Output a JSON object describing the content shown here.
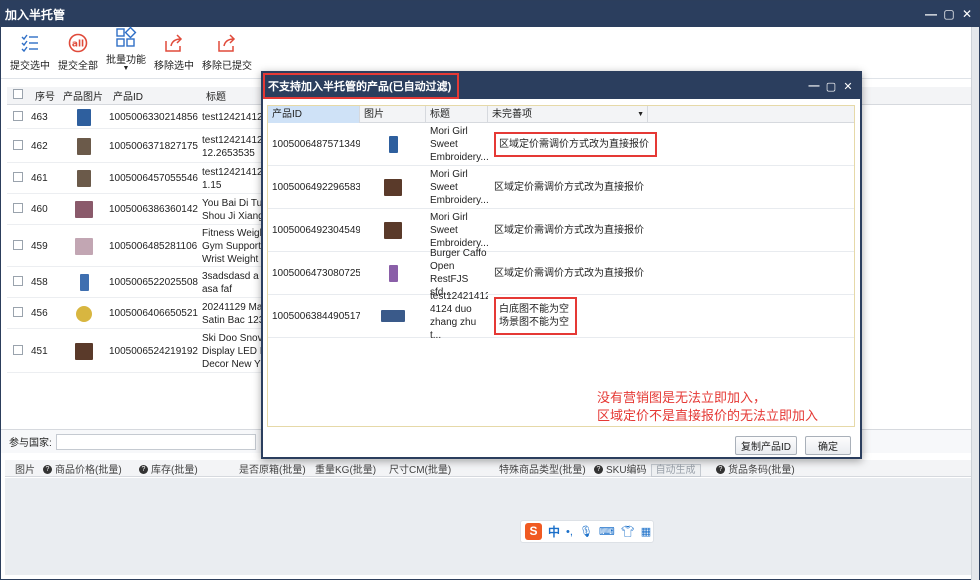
{
  "window": {
    "title": "加入半托管",
    "controls": [
      "—",
      "▢",
      "✕"
    ]
  },
  "toolbar": {
    "submit_selected": "提交选中",
    "submit_all": "提交全部",
    "batch_functions": "批量功能",
    "remove_selected": "移除选中",
    "remove_submitted": "移除已提交"
  },
  "grid": {
    "headers": {
      "no": "序号",
      "image": "产品图片",
      "pid": "产品ID",
      "title": "标题"
    },
    "rows": [
      {
        "no": "463",
        "pid": "1005006330214856",
        "title": "test12421412",
        "color": "#2e5f9e"
      },
      {
        "no": "462",
        "pid": "1005006371827175",
        "title": "test12421412\n12.2653535",
        "color": "#6b5a4a"
      },
      {
        "no": "461",
        "pid": "1005006457055546",
        "title": "test12421412\n1.15",
        "color": "#6b5a4a"
      },
      {
        "no": "460",
        "pid": "1005006386360142",
        "title": "You Bai Di Tu\nShou Ji Xiang",
        "color": "#8a5a6b"
      },
      {
        "no": "459",
        "pid": "1005006485281106",
        "title": "Fitness Weigh\nGym Support\nWrist Weight",
        "color": "#c2a6b3"
      },
      {
        "no": "458",
        "pid": "1005006522025508",
        "title": "3sadsdasd a\nasa faf",
        "color": "#3f6fb0"
      },
      {
        "no": "456",
        "pid": "1005006406650521",
        "title": "20241129 Ma\nSatin Bac 123",
        "color": "#d8b640"
      },
      {
        "no": "451",
        "pid": "1005006524219192",
        "title": "Ski Doo Snov\nDisplay LED I\nDecor New Y",
        "color": "#5a3a2a"
      }
    ]
  },
  "country": {
    "label": "参与国家:"
  },
  "sku": {
    "headers": {
      "image": "图片",
      "price": "商品价格(批量)",
      "stock": "库存(批量)",
      "original_box": "是否原箱(批量)",
      "weight": "重量KG(批量)",
      "size": "尺寸CM(批量)",
      "special_type": "特殊商品类型(批量)",
      "sku_code": "SKU编码",
      "auto_generate": "自动生成",
      "barcode": "货品条码(批量)"
    }
  },
  "ime": {
    "logo": "S",
    "lang": "中"
  },
  "dialog": {
    "title": "不支持加入半托管的产品(已自动过滤)",
    "controls": [
      "—",
      "▢",
      "✕"
    ],
    "headers": {
      "pid": "产品ID",
      "image": "图片",
      "title": "标题",
      "missing": "未完善项"
    },
    "rows": [
      {
        "pid": "1005006487571349",
        "title": "Mori Girl\nSweet\nEmbroidery...",
        "missing": "区域定价需调价方式改为直接报价",
        "color": "#2e5f9e"
      },
      {
        "pid": "1005006492296583",
        "title": "Mori Girl\nSweet\nEmbroidery...",
        "missing": "区域定价需调价方式改为直接报价",
        "color": "#5a3a2a"
      },
      {
        "pid": "1005006492304549",
        "title": "Mori Girl\nSweet\nEmbroidery...",
        "missing": "区域定价需调价方式改为直接报价",
        "color": "#5a3a2a"
      },
      {
        "pid": "1005006473080725",
        "title": "Burger Caffo\nOpen\nRestFJS sfd...",
        "missing": "区域定价需调价方式改为直接报价",
        "color": "#8a5fa8"
      },
      {
        "pid": "1005006384490517",
        "title": "test12421412\n4124  duo\nzhang zhu t...",
        "missing": "白底图不能为空\n场景图不能为空",
        "color": "#3a5a8a"
      }
    ],
    "note_line1": "没有营销图是无法立即加入，",
    "note_line2": "区域定价不是直接报价的无法立即加入",
    "copy_button": "复制产品ID",
    "ok_button": "确定"
  },
  "colors": {
    "titlebar": "#2b3e5e",
    "highlight_red": "#e53935",
    "accent_red": "#e04a3a",
    "accent_blue": "#2f6fc6"
  }
}
